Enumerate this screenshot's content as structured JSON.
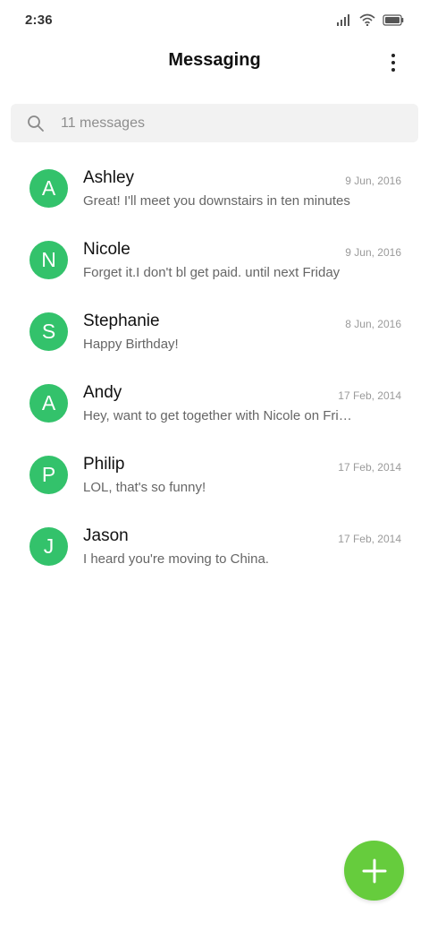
{
  "status_bar": {
    "time": "2:36",
    "icons": [
      "signal-icon",
      "wifi-icon",
      "battery-icon"
    ]
  },
  "header": {
    "title": "Messaging",
    "more_icon": "more-vertical-icon"
  },
  "search": {
    "placeholder": "11 messages",
    "icon": "search-icon"
  },
  "colors": {
    "avatar": "#33c26b",
    "fab": "#66cc3d"
  },
  "conversations": [
    {
      "initial": "A",
      "name": "Ashley",
      "date": "9 Jun, 2016",
      "preview": "Great! I'll meet you downstairs in ten minutes"
    },
    {
      "initial": "N",
      "name": "Nicole",
      "date": "9 Jun, 2016",
      "preview": "Forget it.I don't bl get paid. until next Friday"
    },
    {
      "initial": "S",
      "name": "Stephanie",
      "date": "8 Jun, 2016",
      "preview": "Happy Birthday!"
    },
    {
      "initial": "A",
      "name": "Andy",
      "date": "17 Feb, 2014",
      "preview": "Hey, want to get together with Nicole on Friday?"
    },
    {
      "initial": "P",
      "name": "Philip",
      "date": "17 Feb, 2014",
      "preview": "LOL, that's so funny!"
    },
    {
      "initial": "J",
      "name": "Jason",
      "date": "17 Feb, 2014",
      "preview": "I heard you're moving to China."
    }
  ],
  "fab": {
    "icon": "plus-icon"
  }
}
